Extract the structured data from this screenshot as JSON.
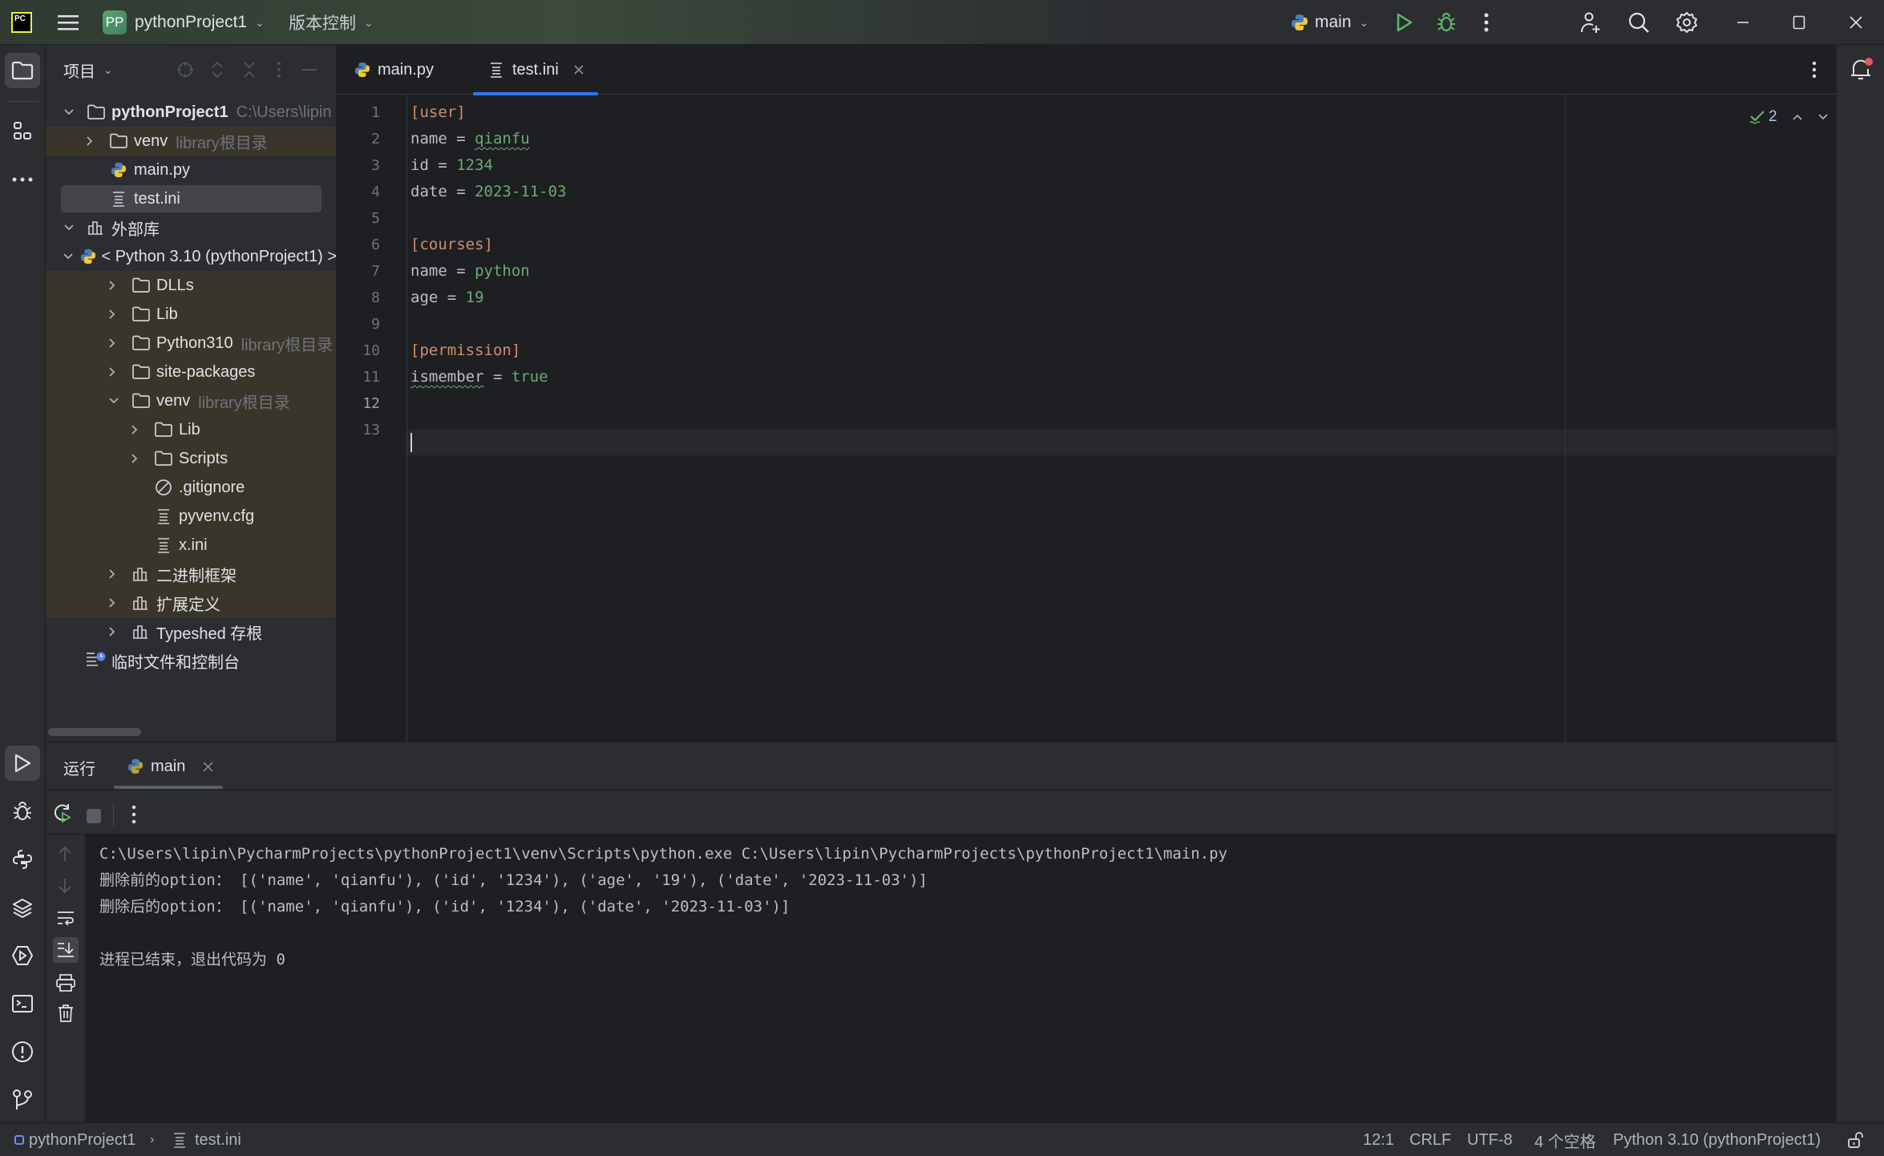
{
  "titlebar": {
    "logo": "PC",
    "project_badge": "PP",
    "project_name": "pythonProject1",
    "vcs_label": "版本控制",
    "run_config": "main",
    "icons": [
      "hamburger-menu-icon",
      "run-icon",
      "debug-icon",
      "more-icon",
      "add-user-icon",
      "search-icon",
      "settings-icon",
      "minimize-icon",
      "maximize-icon",
      "close-icon"
    ]
  },
  "project_panel": {
    "title": "项目",
    "tree": [
      {
        "label": "pythonProject1",
        "hint": "C:\\Users\\lipin",
        "icon": "folder",
        "arrow": "down",
        "level": 0,
        "bold": true
      },
      {
        "label": "venv",
        "hint": "library根目录",
        "icon": "folder",
        "arrow": "right",
        "level": 1,
        "lib": true
      },
      {
        "label": "main.py",
        "hint": "",
        "icon": "python",
        "arrow": "",
        "level": 1
      },
      {
        "label": "test.ini",
        "hint": "",
        "icon": "ini",
        "arrow": "",
        "level": 1,
        "selected": true
      },
      {
        "label": "外部库",
        "hint": "",
        "icon": "library",
        "arrow": "down",
        "level": 0
      },
      {
        "label": "< Python 3.10 (pythonProject1) >",
        "hint": "",
        "icon": "python",
        "arrow": "down",
        "level": 1
      },
      {
        "label": "DLLs",
        "hint": "",
        "icon": "folder",
        "arrow": "right",
        "level": 2,
        "lib": true
      },
      {
        "label": "Lib",
        "hint": "",
        "icon": "folder",
        "arrow": "right",
        "level": 2,
        "lib": true
      },
      {
        "label": "Python310",
        "hint": "library根目录",
        "icon": "folder",
        "arrow": "right",
        "level": 2,
        "lib": true
      },
      {
        "label": "site-packages",
        "hint": "",
        "icon": "folder",
        "arrow": "right",
        "level": 2,
        "lib": true
      },
      {
        "label": "venv",
        "hint": "library根目录",
        "icon": "folder",
        "arrow": "down",
        "level": 2,
        "lib": true
      },
      {
        "label": "Lib",
        "hint": "",
        "icon": "folder",
        "arrow": "right",
        "level": 3,
        "lib": true
      },
      {
        "label": "Scripts",
        "hint": "",
        "icon": "folder",
        "arrow": "right",
        "level": 3,
        "lib": true
      },
      {
        "label": ".gitignore",
        "hint": "",
        "icon": "ignore",
        "arrow": "",
        "level": 3,
        "lib": true
      },
      {
        "label": "pyvenv.cfg",
        "hint": "",
        "icon": "ini",
        "arrow": "",
        "level": 3,
        "lib": true
      },
      {
        "label": "x.ini",
        "hint": "",
        "icon": "ini",
        "arrow": "",
        "level": 3,
        "lib": true
      },
      {
        "label": "二进制框架",
        "hint": "",
        "icon": "library",
        "arrow": "right",
        "level": 2,
        "lib": true
      },
      {
        "label": "扩展定义",
        "hint": "",
        "icon": "library",
        "arrow": "right",
        "level": 2,
        "lib": true
      },
      {
        "label": "Typeshed 存根",
        "hint": "",
        "icon": "library",
        "arrow": "right",
        "level": 2
      },
      {
        "label": "临时文件和控制台",
        "hint": "",
        "icon": "scratch",
        "arrow": "",
        "level": 0
      }
    ]
  },
  "editor": {
    "tabs": [
      {
        "label": "main.py",
        "icon": "python",
        "active": false
      },
      {
        "label": "test.ini",
        "icon": "ini",
        "active": true
      }
    ],
    "inspections_count": "2",
    "lines": [
      [
        {
          "t": "[user]",
          "c": "sec"
        }
      ],
      [
        {
          "t": "name",
          "c": "key"
        },
        {
          "t": " = ",
          "c": "key"
        },
        {
          "t": "qianfu",
          "c": "val",
          "squiggle": true
        }
      ],
      [
        {
          "t": "id",
          "c": "key"
        },
        {
          "t": " = ",
          "c": "key"
        },
        {
          "t": "1234",
          "c": "val"
        }
      ],
      [
        {
          "t": "date",
          "c": "key"
        },
        {
          "t": " = ",
          "c": "key"
        },
        {
          "t": "2023-11-03",
          "c": "val"
        }
      ],
      [],
      [
        {
          "t": "[courses]",
          "c": "sec"
        }
      ],
      [
        {
          "t": "name",
          "c": "key"
        },
        {
          "t": " = ",
          "c": "key"
        },
        {
          "t": "python",
          "c": "val"
        }
      ],
      [
        {
          "t": "age",
          "c": "key"
        },
        {
          "t": " = ",
          "c": "key"
        },
        {
          "t": "19",
          "c": "val"
        }
      ],
      [],
      [
        {
          "t": "[permission]",
          "c": "sec"
        }
      ],
      [
        {
          "t": "ismember",
          "c": "key",
          "squiggle": true
        },
        {
          "t": " = ",
          "c": "key"
        },
        {
          "t": "true",
          "c": "val"
        }
      ],
      [],
      []
    ],
    "current_line": 12
  },
  "run_panel": {
    "title": "运行",
    "tab_label": "main",
    "console": [
      "C:\\Users\\lipin\\PycharmProjects\\pythonProject1\\venv\\Scripts\\python.exe C:\\Users\\lipin\\PycharmProjects\\pythonProject1\\main.py",
      "删除前的option： [('name', 'qianfu'), ('id', '1234'), ('age', '19'), ('date', '2023-11-03')]",
      "删除后的option： [('name', 'qianfu'), ('id', '1234'), ('date', '2023-11-03')]",
      "",
      "进程已结束，退出代码为 0"
    ]
  },
  "statusbar": {
    "breadcrumb_project": "pythonProject1",
    "breadcrumb_file": "test.ini",
    "position": "12:1",
    "line_ending": "CRLF",
    "encoding": "UTF-8",
    "indent": "4 个空格",
    "interpreter": "Python 3.10 (pythonProject1)"
  },
  "colors": {
    "accent": "#3574f0",
    "section": "#cf8e6d",
    "value": "#6aab73",
    "run_green": "#5fb865",
    "notification_dot": "#e55b5b"
  }
}
